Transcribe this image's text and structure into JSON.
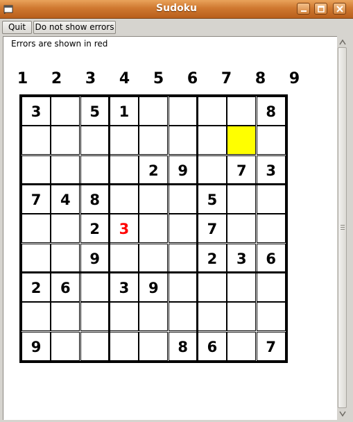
{
  "window": {
    "title": "Sudoku"
  },
  "toolbar": {
    "quit_label": "Quit",
    "errors_toggle_label": "Do not show errors"
  },
  "info_text": "Errors are shown in red",
  "column_numbers": [
    "1",
    "2",
    "3",
    "4",
    "5",
    "6",
    "7",
    "8",
    "9"
  ],
  "board": {
    "rows": [
      [
        "3",
        "",
        "5",
        "1",
        "",
        "",
        "",
        "",
        "8"
      ],
      [
        "",
        "",
        "",
        "",
        "",
        "",
        "",
        "",
        ""
      ],
      [
        "",
        "",
        "",
        "",
        "2",
        "9",
        "",
        "7",
        "3"
      ],
      [
        "7",
        "4",
        "8",
        "",
        "",
        "",
        "5",
        "",
        ""
      ],
      [
        "",
        "",
        "2",
        "3",
        "",
        "",
        "7",
        "",
        ""
      ],
      [
        "",
        "",
        "9",
        "",
        "",
        "",
        "2",
        "3",
        "6"
      ],
      [
        "2",
        "6",
        "",
        "3",
        "9",
        "",
        "",
        "",
        ""
      ],
      [
        "",
        "",
        "",
        "",
        "",
        "",
        "",
        "",
        ""
      ],
      [
        "9",
        "",
        "",
        "",
        "",
        "8",
        "6",
        "",
        "7"
      ]
    ],
    "selected_cell": {
      "row": 1,
      "col": 7
    },
    "error_cells": [
      {
        "row": 4,
        "col": 3
      }
    ],
    "colors": {
      "error": "#ff0000",
      "selected": "#ffff00",
      "grid": "#000000"
    }
  },
  "icons": {
    "window_menu": "window-menu-icon",
    "minimize": "minimize-icon",
    "maximize": "maximize-icon",
    "close": "close-icon",
    "scroll_up": "arrow-up-icon",
    "scroll_down": "arrow-down-icon"
  }
}
